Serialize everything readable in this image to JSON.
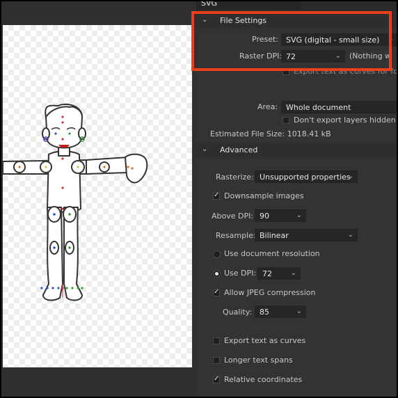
{
  "top_format": "SVG",
  "file_settings": {
    "section_title": "File Settings",
    "preset_label": "Preset:",
    "preset_value": "SVG (digital - small size)",
    "raster_dpi_label": "Raster DPI:",
    "raster_dpi_value": "72",
    "raster_dpi_note": "(Nothing w",
    "export_text_curves_font": "Export text as curves for font in",
    "area_label": "Area:",
    "area_value": "Whole document",
    "dont_export_hidden": "Don't export layers hidden by",
    "estimated_size": "Estimated File Size: 1018.41 kB"
  },
  "advanced": {
    "section_title": "Advanced",
    "rasterize_label": "Rasterize:",
    "rasterize_value": "Unsupported properties",
    "downsample_label": "Downsample images",
    "above_dpi_label": "Above DPI:",
    "above_dpi_value": "90",
    "resample_label": "Resample:",
    "resample_value": "Bilinear",
    "use_doc_res_label": "Use document resolution",
    "use_dpi_label": "Use DPI:",
    "use_dpi_value": "72",
    "allow_jpeg_label": "Allow JPEG compression",
    "quality_label": "Quality:",
    "quality_value": "85",
    "export_text_curves_label": "Export text as curves",
    "longer_spans_label": "Longer text spans",
    "relative_coords_label": "Relative coordinates"
  },
  "colors": {
    "highlight": "#e8401c",
    "panel": "#333333"
  }
}
